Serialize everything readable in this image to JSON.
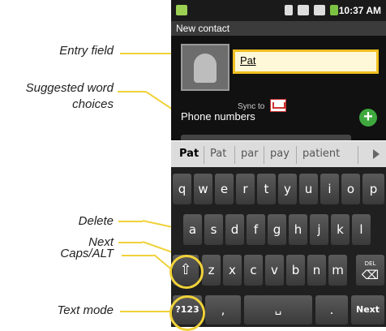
{
  "callouts": {
    "entry_field": "Entry field",
    "suggested_line1": "Suggested word",
    "suggested_line2": "choices",
    "delete": "Delete",
    "next": "Next",
    "caps_alt": "Caps/ALT",
    "text_mode": "Text mode"
  },
  "status_bar": {
    "time": "10:37 AM"
  },
  "title_bar": {
    "title": "New contact"
  },
  "contact": {
    "name_value": "Pat",
    "sync_to_label": "Sync to",
    "phone_numbers_label": "Phone numbers",
    "add_symbol": "+"
  },
  "suggestions": [
    "Pat",
    "Pat",
    "par",
    "pay",
    "patient"
  ],
  "keyboard": {
    "row1": [
      "q",
      "w",
      "e",
      "r",
      "t",
      "y",
      "u",
      "i",
      "o",
      "p"
    ],
    "row2": [
      "a",
      "s",
      "d",
      "f",
      "g",
      "h",
      "j",
      "k",
      "l"
    ],
    "row3": [
      "z",
      "x",
      "c",
      "v",
      "b",
      "n",
      "m"
    ],
    "shift_symbol": "⇧",
    "delete_label": "DEL",
    "delete_symbol": "⌫",
    "mode_label": "?123",
    "comma": ",",
    "space_symbol": "␣",
    "period": ".",
    "next_label": "Next"
  },
  "colors": {
    "callout_line": "#f0d23a",
    "entry_border": "#f0c020",
    "add_button": "#3fa83f"
  }
}
